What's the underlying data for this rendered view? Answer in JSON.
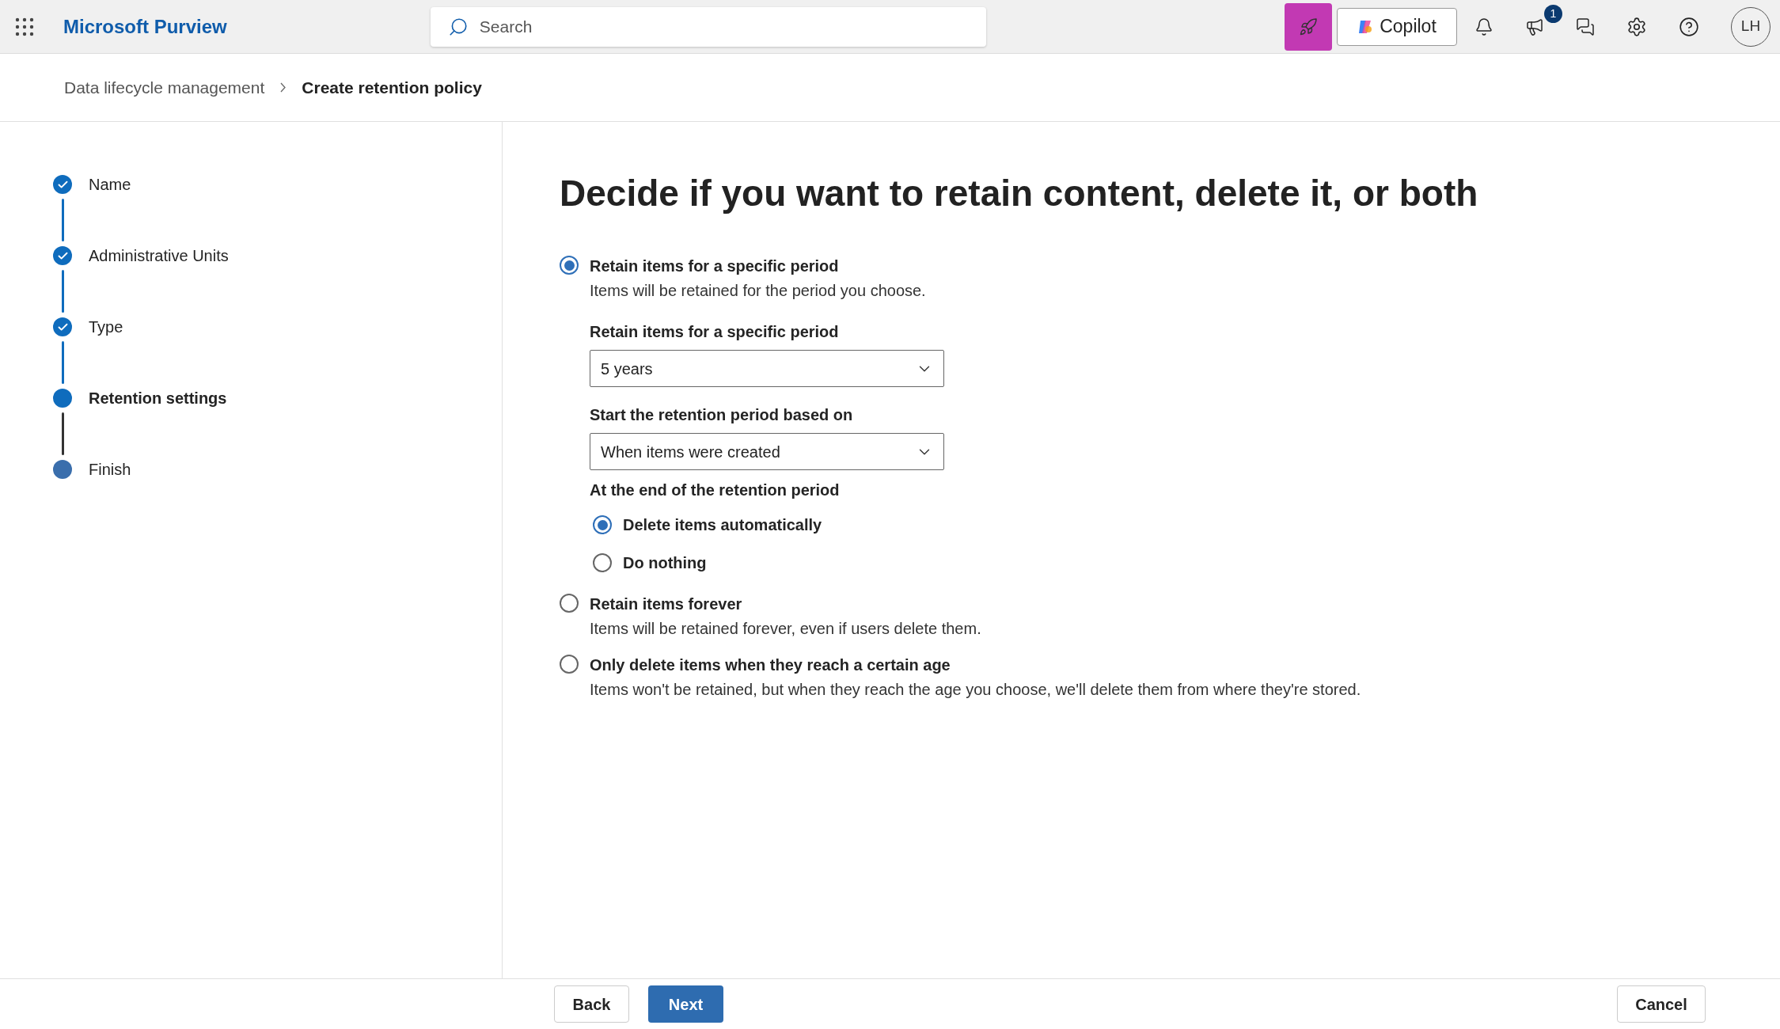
{
  "header": {
    "app_name": "Microsoft Purview",
    "search": {
      "placeholder": "Search"
    },
    "copilot_label": "Copilot",
    "notification_badge": "1",
    "avatar_initials": "LH"
  },
  "breadcrumb": [
    {
      "label": "Data lifecycle management",
      "current": false
    },
    {
      "label": "Create retention policy",
      "current": true
    }
  ],
  "steps": [
    {
      "label": "Name",
      "completed": true,
      "current": false
    },
    {
      "label": "Administrative Units",
      "completed": true,
      "current": false
    },
    {
      "label": "Type",
      "completed": true,
      "current": false
    },
    {
      "label": "Retention settings",
      "completed": false,
      "current": true
    },
    {
      "label": "Finish",
      "completed": false,
      "current": false
    }
  ],
  "title": "Decide if you want to retain content, delete it, or both",
  "options": [
    {
      "label": "Retain items for a specific period",
      "description": "Items will be retained for the period you choose.",
      "selected": true,
      "details": {
        "period_label": "Retain items for a specific period",
        "period_value": "5 years",
        "start_label": "Start the retention period based on",
        "start_value": "When items were created",
        "end_label": "At the end of the retention period",
        "end_options": [
          {
            "label": "Delete items automatically",
            "selected": true
          },
          {
            "label": "Do nothing",
            "selected": false
          }
        ]
      }
    },
    {
      "label": "Retain items forever",
      "description": "Items will be retained forever, even if users delete them.",
      "selected": false
    },
    {
      "label": "Only delete items when they reach a certain age",
      "description": "Items won't be retained, but when they reach the age you choose, we'll delete them from where they're stored.",
      "selected": false
    }
  ],
  "footer": {
    "back": "Back",
    "next": "Next",
    "cancel": "Cancel"
  }
}
